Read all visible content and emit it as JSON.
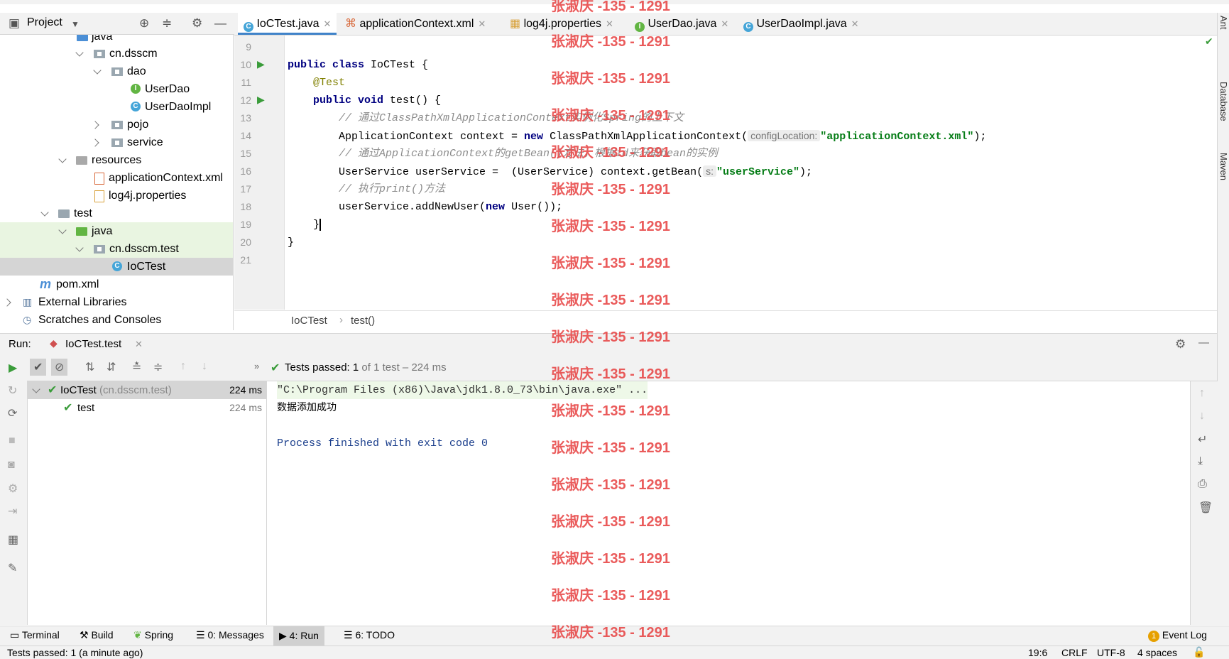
{
  "colors": {
    "accent": "#4083c9",
    "pass_green": "#62b543",
    "keyword": "#000080",
    "string": "#067d17",
    "comment": "#8c8c8c",
    "annotation": "#808000",
    "watermark": "#e84a4a"
  },
  "project_panel": {
    "title": "Project",
    "tree": [
      {
        "label": "java"
      },
      {
        "label": "cn.dsscm"
      },
      {
        "label": "dao"
      },
      {
        "label": "UserDao"
      },
      {
        "label": "UserDaoImpl"
      },
      {
        "label": "pojo"
      },
      {
        "label": "service"
      },
      {
        "label": "resources"
      },
      {
        "label": "applicationContext.xml"
      },
      {
        "label": "log4j.properties"
      },
      {
        "label": "test"
      },
      {
        "label": "java"
      },
      {
        "label": "cn.dsscm.test"
      },
      {
        "label": "IoCTest"
      },
      {
        "label": "pom.xml"
      },
      {
        "label": "External Libraries"
      },
      {
        "label": "Scratches and Consoles"
      }
    ]
  },
  "tabs": [
    {
      "label": "IoCTest.java",
      "icon": "class-icon"
    },
    {
      "label": "applicationContext.xml",
      "icon": "xml-icon"
    },
    {
      "label": "log4j.properties",
      "icon": "properties-icon"
    },
    {
      "label": "UserDao.java",
      "icon": "interface-icon"
    },
    {
      "label": "UserDaoImpl.java",
      "icon": "class-icon"
    }
  ],
  "editor": {
    "line_numbers": [
      "9",
      "10",
      "11",
      "12",
      "13",
      "14",
      "15",
      "16",
      "17",
      "18",
      "19",
      "20",
      "21"
    ],
    "code": {
      "l10_kw": "public class",
      "l10_rest": " IoCTest {",
      "l11": "@Test",
      "l12_kw": "public void",
      "l12_rest": " test() {",
      "l13": "// 通过ClassPathXmlApplicationContext实例化Spring的上下文",
      "l14_a": "ApplicationContext context = ",
      "l14_kw": "new",
      "l14_b": " ClassPathXmlApplicationContext(",
      "l14_hint": "configLocation:",
      "l14_str": "\"applicationContext.xml\"",
      "l14_end": ");",
      "l15": "// 通过ApplicationContext的getBean()方法，根据id来获取bean的实例",
      "l16_a": "UserService userService =  (UserService) context.getBean(",
      "l16_hint": "s:",
      "l16_str": "\"userService\"",
      "l16_end": ");",
      "l17": "// 执行print()方法",
      "l18_a": "userService.addNewUser(",
      "l18_kw": "new",
      "l18_b": " User());",
      "l19": "}",
      "l20": "}"
    },
    "breadcrumb": [
      "IoCTest",
      "test()"
    ]
  },
  "right_strip": [
    "Ant",
    "Database",
    "Maven"
  ],
  "run": {
    "label": "Run:",
    "tab": "IoCTest.test",
    "status_strong": "Tests passed: 1",
    "status_rest": " of 1 test – 224 ms",
    "tree": [
      {
        "name": "IoCTest",
        "pkg": "(cn.dsscm.test)",
        "time": "224 ms"
      },
      {
        "name": "test",
        "time": "224 ms"
      }
    ],
    "console": [
      "\"C:\\Program Files (x86)\\Java\\jdk1.8.0_73\\bin\\java.exe\" ...",
      "数据添加成功",
      "",
      "Process finished with exit code 0"
    ]
  },
  "tool_windows": [
    {
      "label": "Terminal"
    },
    {
      "label": "Build"
    },
    {
      "label": "Spring"
    },
    {
      "label": "0: Messages"
    },
    {
      "label": "4: Run"
    },
    {
      "label": "6: TODO"
    }
  ],
  "event_log": {
    "count": "1",
    "label": "Event Log"
  },
  "status": {
    "message": "Tests passed: 1 (a minute ago)",
    "position": "19:6",
    "line_sep": "CRLF",
    "encoding": "UTF-8",
    "indent": "4 spaces"
  },
  "watermark": "张淑庆 -135 - 1291"
}
